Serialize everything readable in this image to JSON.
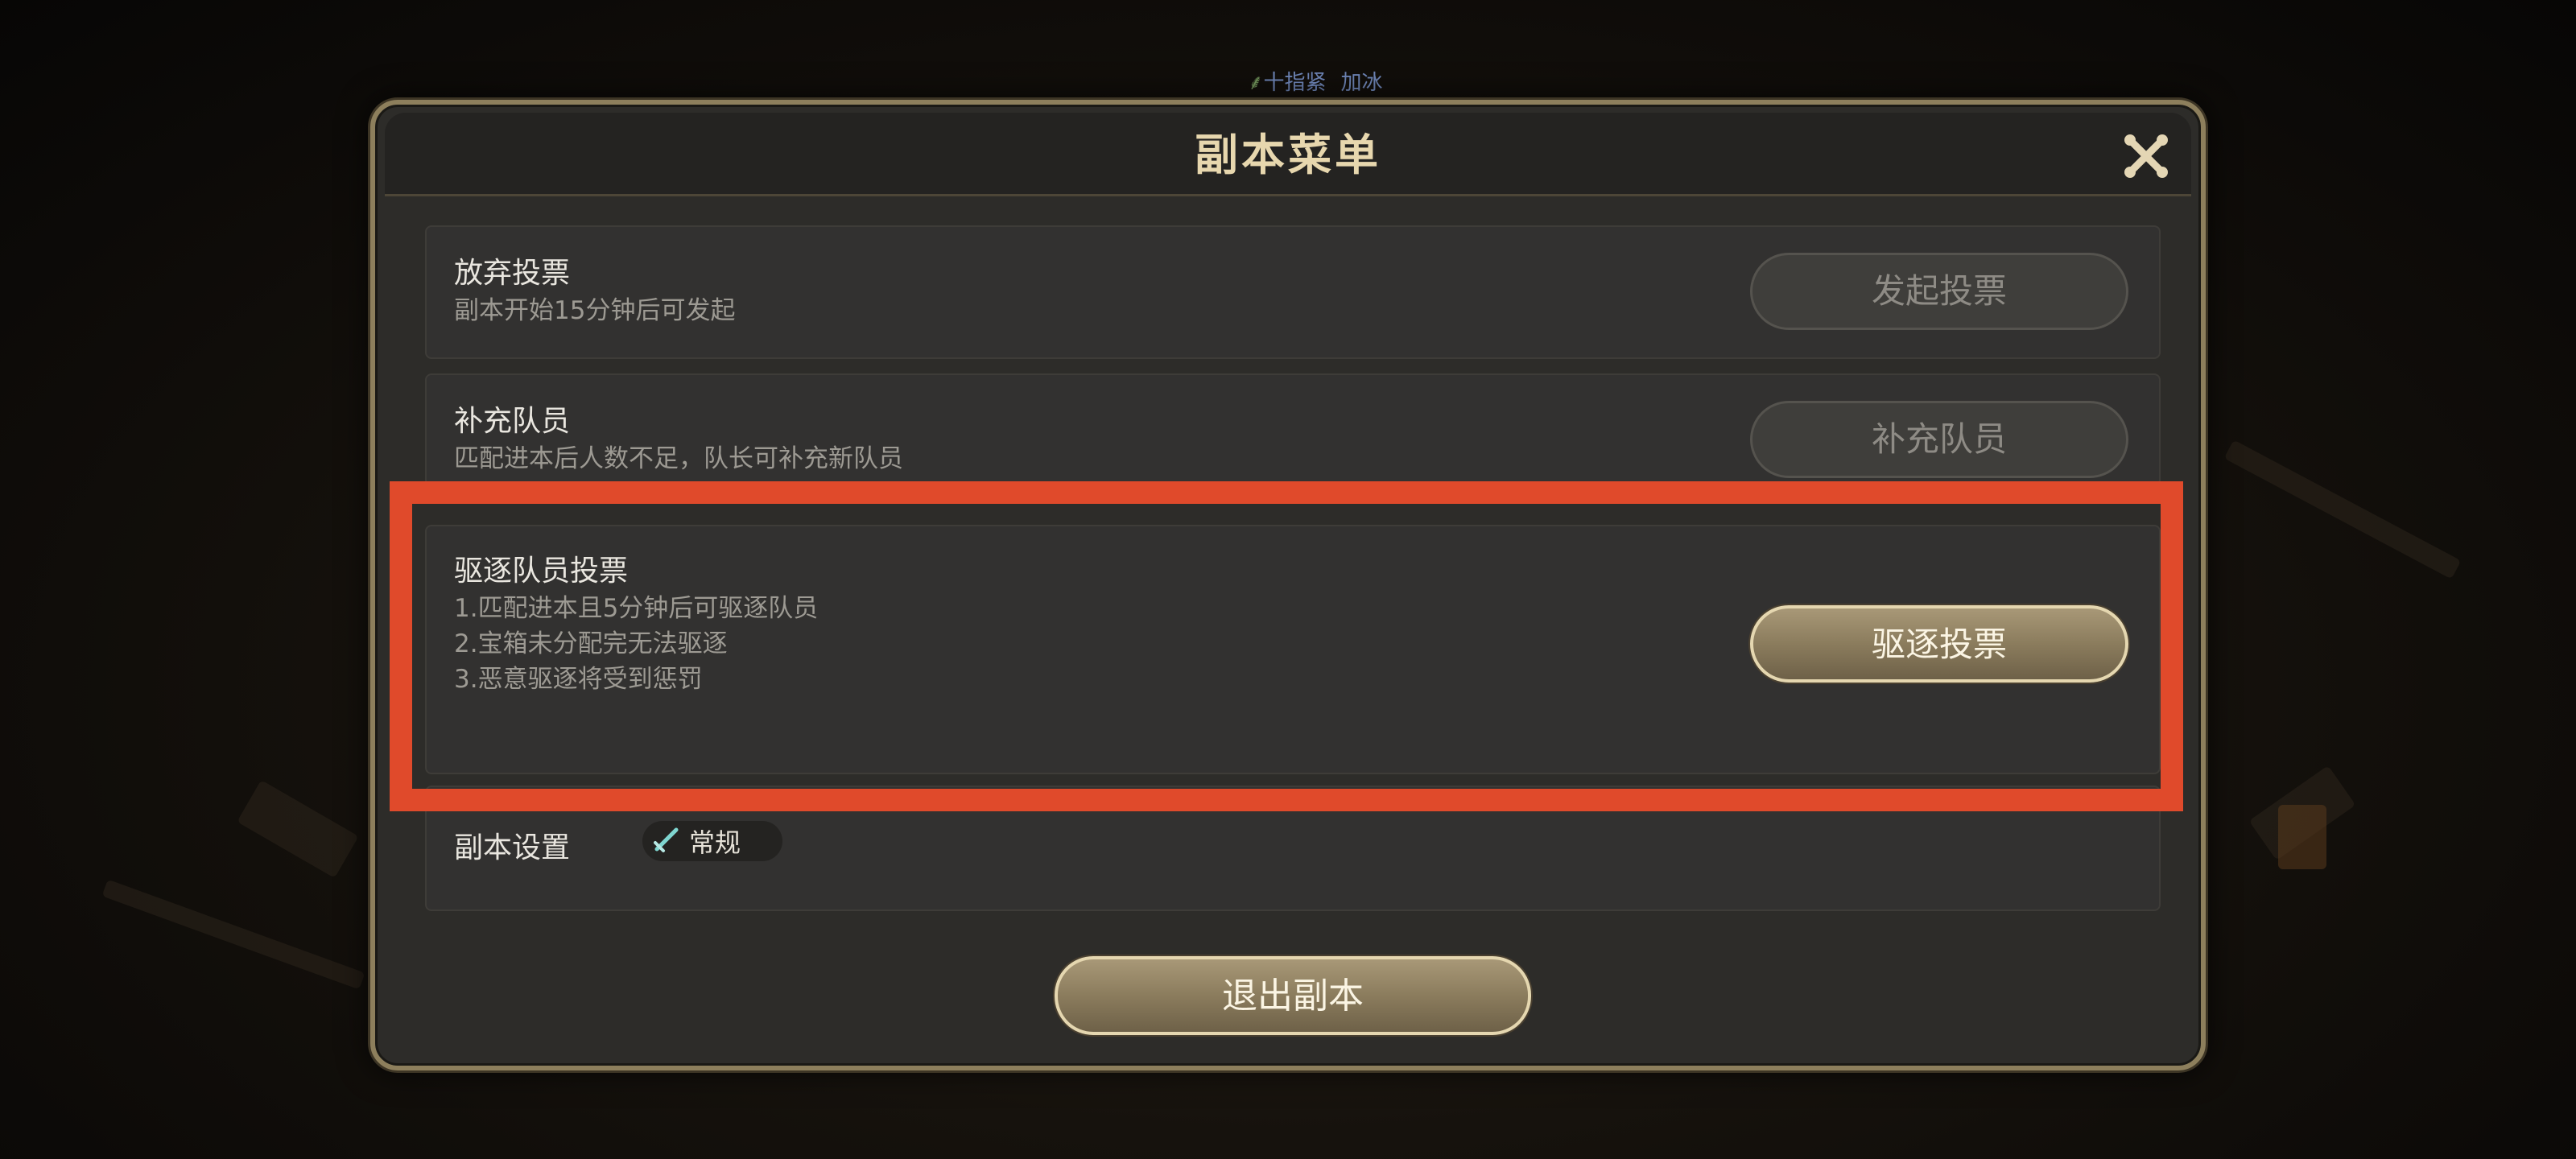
{
  "background": {
    "player_names": [
      "十指紧",
      "加冰"
    ]
  },
  "dialog": {
    "title": "副本菜单",
    "close_icon": "close-x-icon"
  },
  "rows": {
    "abandon_vote": {
      "title": "放弃投票",
      "desc": "副本开始15分钟后可发起",
      "button": "发起投票",
      "enabled": false
    },
    "replenish": {
      "title": "补充队员",
      "desc": "匹配进本后人数不足，队长可补充新队员",
      "button": "补充队员",
      "enabled": false
    },
    "kick_vote": {
      "title": "驱逐队员投票",
      "desc_lines": [
        "1.匹配进本且5分钟后可驱逐队员",
        "2.宝箱未分配完无法驱逐",
        "3.恶意驱逐将受到惩罚"
      ],
      "button": "驱逐投票",
      "enabled": true
    },
    "settings": {
      "label": "副本设置",
      "mode": "常规",
      "mode_icon": "sword-icon"
    }
  },
  "exit_button": "退出副本",
  "colors": {
    "highlight": "#e04a2b",
    "gold_text": "#e7d7ae",
    "panel": "#2d2c29"
  }
}
